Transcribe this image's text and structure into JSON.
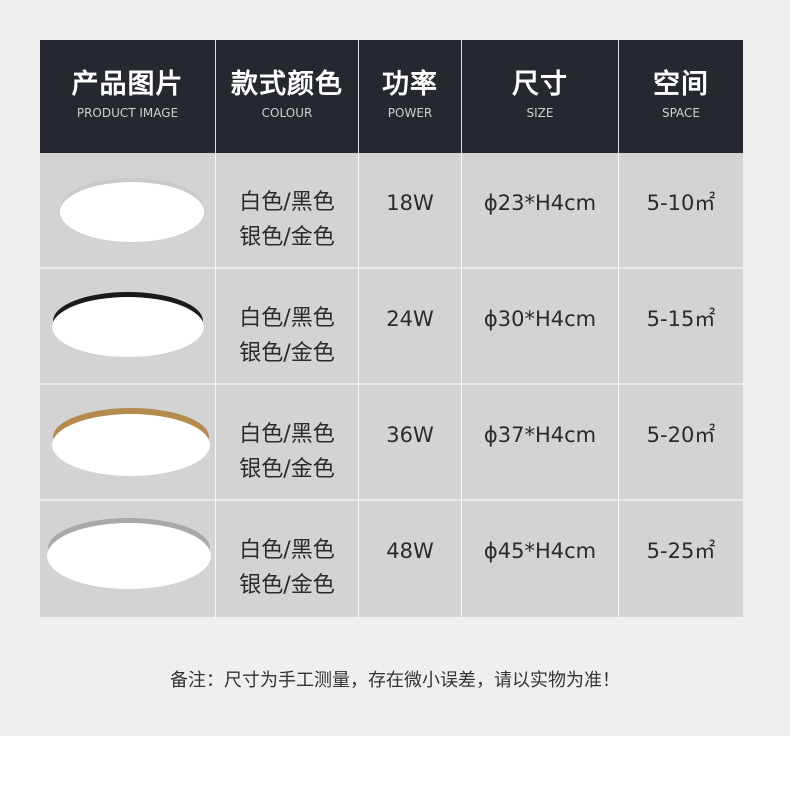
{
  "headers": [
    {
      "zh": "产品图片",
      "en": "PRODUCT IMAGE"
    },
    {
      "zh": "款式颜色",
      "en": "COLOUR"
    },
    {
      "zh": "功率",
      "en": "POWER"
    },
    {
      "zh": "尺寸",
      "en": "SIZE"
    },
    {
      "zh": "空间",
      "en": "SPACE"
    }
  ],
  "rows": [
    {
      "rim_color": "#c9c9c9",
      "colour_line1": "白色/黑色",
      "colour_line2": "银色/金色",
      "power": "18W",
      "size": "ϕ23*H4cm",
      "space": "5-10㎡"
    },
    {
      "rim_color": "#1a1a1a",
      "colour_line1": "白色/黑色",
      "colour_line2": "银色/金色",
      "power": "24W",
      "size": "ϕ30*H4cm",
      "space": "5-15㎡"
    },
    {
      "rim_color": "#b58a4e",
      "colour_line1": "白色/黑色",
      "colour_line2": "银色/金色",
      "power": "36W",
      "size": "ϕ37*H4cm",
      "space": "5-20㎡"
    },
    {
      "rim_color": "#a9a9a9",
      "colour_line1": "白色/黑色",
      "colour_line2": "银色/金色",
      "power": "48W",
      "size": "ϕ45*H4cm",
      "space": "5-25㎡"
    }
  ],
  "note": "备注：尺寸为手工测量，存在微小误差，请以实物为准！",
  "colors": {
    "header_bg": "#262830",
    "row_bg": "#d3d3d3",
    "page_bg": "#efefef"
  }
}
